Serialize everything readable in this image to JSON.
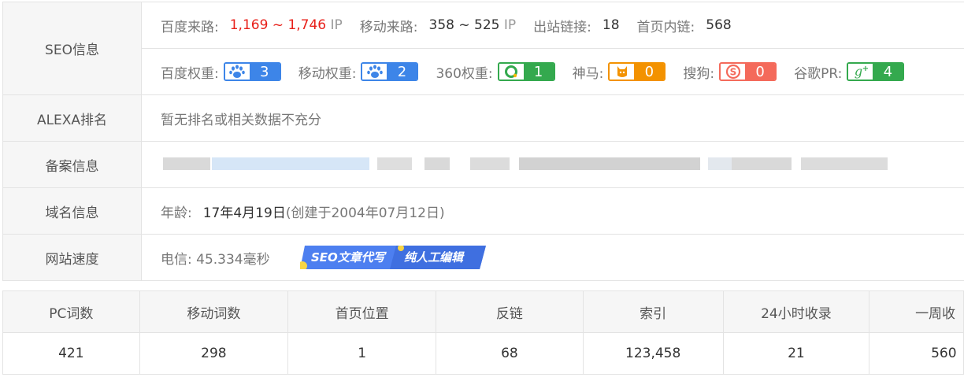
{
  "seo": {
    "label": "SEO信息",
    "baidu_traffic_label": "百度来路:",
    "baidu_traffic_value": "1,169 ~ 1,746",
    "baidu_traffic_unit": "IP",
    "mobile_traffic_label": "移动来路:",
    "mobile_traffic_value": "358 ~ 525",
    "mobile_traffic_unit": "IP",
    "outbound_label": "出站链接:",
    "outbound_value": "18",
    "internal_label": "首页内链:",
    "internal_value": "568",
    "weights": [
      {
        "label": "百度权重:",
        "icon": "baidu-paw-icon",
        "value": "3",
        "color": "#3d85e8"
      },
      {
        "label": "移动权重:",
        "icon": "baidu-mobile-paw-icon",
        "value": "2",
        "color": "#3d85e8"
      },
      {
        "label": "360权重:",
        "icon": "360-search-icon",
        "value": "1",
        "color": "#34a94e"
      },
      {
        "label": "神马:",
        "icon": "shenma-icon",
        "value": "0",
        "color": "#f39200"
      },
      {
        "label": "搜狗:",
        "icon": "sogou-icon",
        "value": "0",
        "color": "#f46a5b"
      },
      {
        "label": "谷歌PR:",
        "icon": "google-plus-icon",
        "value": "4",
        "color": "#34a94e"
      }
    ]
  },
  "alexa": {
    "label": "ALEXA排名",
    "value": "暂无排名或相关数据不充分"
  },
  "icp": {
    "label": "备案信息"
  },
  "domain": {
    "label": "域名信息",
    "age_label": "年龄:",
    "age_value": "17年4月19日",
    "created": "(创建于2004年07月12日)"
  },
  "speed": {
    "label": "网站速度",
    "value": "电信: 45.334毫秒",
    "promo_left": "SEO文章代写",
    "promo_right": "纯人工编辑"
  },
  "stats": {
    "headers": [
      "PC词数",
      "移动词数",
      "首页位置",
      "反链",
      "索引",
      "24小时收录",
      "一周收"
    ],
    "values": [
      "421",
      "298",
      "1",
      "68",
      "123,458",
      "21",
      "560"
    ]
  }
}
